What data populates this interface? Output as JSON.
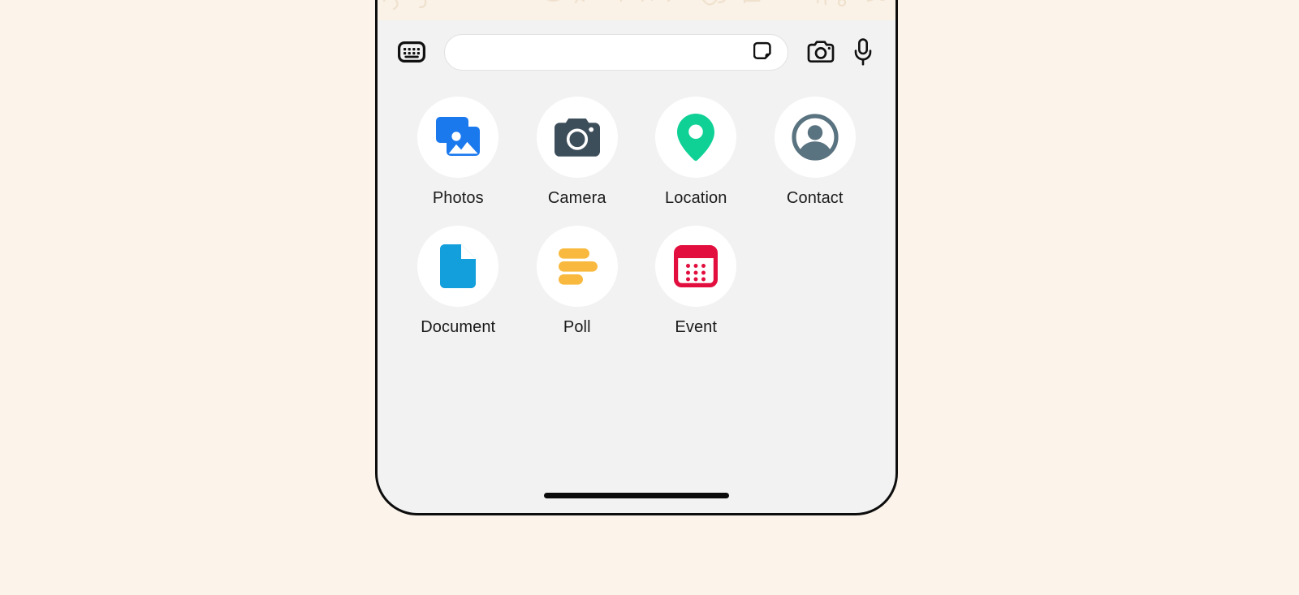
{
  "theme": {
    "page_background": "#FCF3EA",
    "panel_background": "#F2F2F2",
    "wallpaper_background": "#FAF2E7",
    "doodle_color": "#EFE0CC",
    "circle_background": "#FFFFFF",
    "label_color": "#1B1B1B",
    "frame_color": "#0D0D0D",
    "input_background": "#FFFFFF",
    "input_border": "#E2E2E2"
  },
  "composer": {
    "keyboard_button": {
      "icon": "keyboard-icon",
      "label": "Keyboard"
    },
    "input": {
      "value": "",
      "placeholder": ""
    },
    "sticker_button": {
      "icon": "sticker-icon",
      "label": "Sticker"
    },
    "camera_button": {
      "icon": "camera-outline-icon",
      "label": "Camera"
    },
    "mic_button": {
      "icon": "microphone-icon",
      "label": "Voice message"
    }
  },
  "attachments": {
    "items": [
      {
        "id": "photos",
        "label": "Photos",
        "icon": "photos-icon",
        "color": "#1B79EE"
      },
      {
        "id": "camera",
        "label": "Camera",
        "icon": "camera-icon",
        "color": "#3D4E5B"
      },
      {
        "id": "location",
        "label": "Location",
        "icon": "location-pin-icon",
        "color": "#0FD196"
      },
      {
        "id": "contact",
        "label": "Contact",
        "icon": "contact-icon",
        "color": "#5A7380"
      },
      {
        "id": "document",
        "label": "Document",
        "icon": "document-icon",
        "color": "#139FDC"
      },
      {
        "id": "poll",
        "label": "Poll",
        "icon": "poll-icon",
        "color": "#F8B93E"
      },
      {
        "id": "event",
        "label": "Event",
        "icon": "event-calendar-icon",
        "color": "#E20E3E"
      }
    ]
  },
  "system": {
    "home_indicator": {
      "name": "home-indicator"
    }
  }
}
